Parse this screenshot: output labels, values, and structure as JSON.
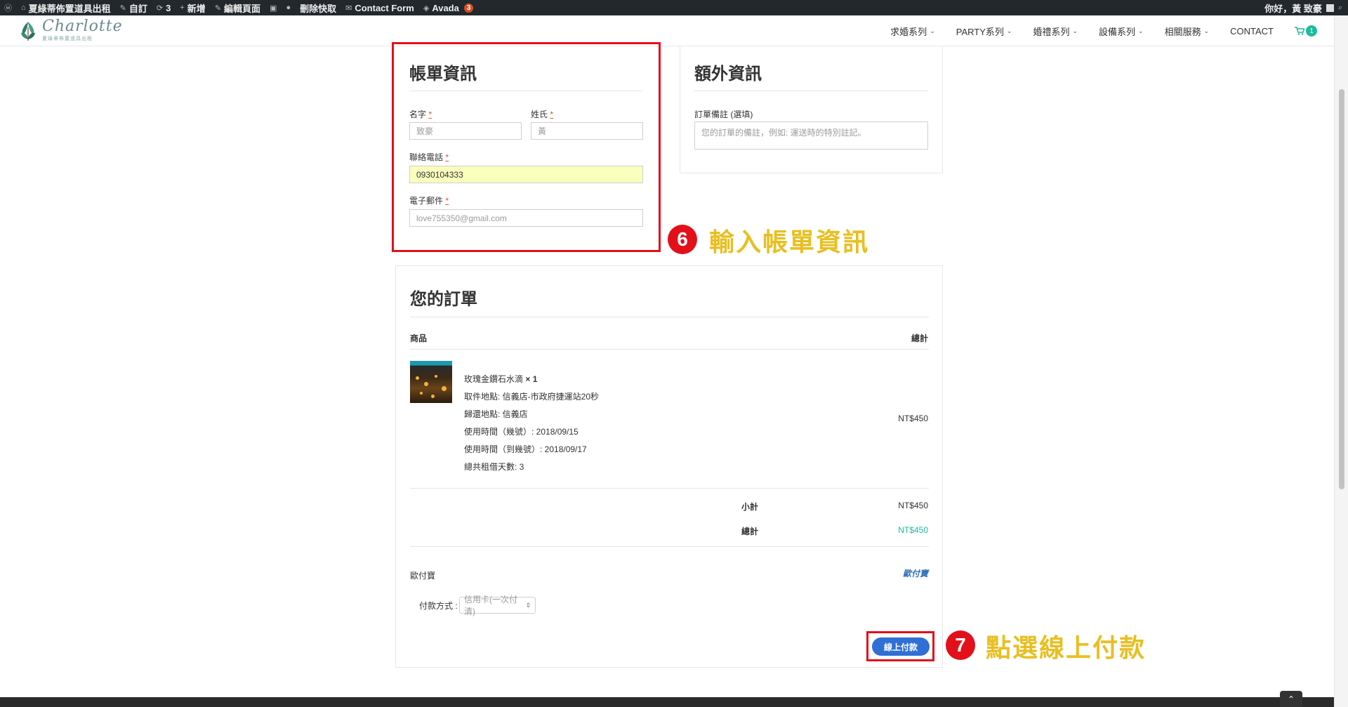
{
  "admin_bar": {
    "site_name": "夏綠蒂佈置道具出租",
    "customize": "自訂",
    "updates_count": "3",
    "new": "新增",
    "edit_page": "編輯頁面",
    "purge_cache": "刪除快取",
    "contact_form": "Contact Form",
    "avada": "Avada",
    "avada_badge": "3",
    "greeting": "你好，黃 致豪"
  },
  "header": {
    "logo_text": "Charlotte",
    "logo_sub": "夏綠蒂佈置道具出租",
    "nav": [
      {
        "label": "求婚系列"
      },
      {
        "label": "PARTY系列"
      },
      {
        "label": "婚禮系列"
      },
      {
        "label": "設備系列"
      },
      {
        "label": "相關服務"
      },
      {
        "label": "CONTACT"
      }
    ],
    "cart_count": "1"
  },
  "billing": {
    "title": "帳單資訊",
    "first_name_label": "名字",
    "first_name_placeholder": "致豪",
    "last_name_label": "姓氏",
    "last_name_placeholder": "黃",
    "phone_label": "聯絡電話",
    "phone_value": "0930104333",
    "email_label": "電子郵件",
    "email_placeholder": "love755350@gmail.com",
    "required_mark": "*"
  },
  "additional": {
    "title": "額外資訊",
    "notes_label": "訂單備註 (選填)",
    "notes_placeholder": "您的訂單的備註，例如: 運送時的特別註記。"
  },
  "order": {
    "title": "您的訂單",
    "col_product": "商品",
    "col_total": "總計",
    "item": {
      "name": "玫瑰金鑽石水滴",
      "qty": "× 1",
      "pickup": "取件地點: 信義店-市政府捷運站20秒",
      "return": "歸還地點: 信義店",
      "start": "使用時間（幾號）: 2018/09/15",
      "end": "使用時間（到幾號）: 2018/09/17",
      "days": "總共租借天數: 3",
      "price": "NT$450"
    },
    "subtotal_label": "小計",
    "subtotal": "NT$450",
    "total_label": "總計",
    "total": "NT$450",
    "payment_name": "歐付寶",
    "payment_logo": "歐付寶",
    "payment_method_label": "付款方式 :",
    "payment_method_value": "信用卡(一次付清)",
    "pay_button": "線上付款"
  },
  "annotations": {
    "step6_number": "6",
    "step6_text": "輸入帳單資訊",
    "step7_number": "7",
    "step7_text": "點選線上付款",
    "colors": {
      "frame": "#e3101a",
      "text": "#e8bf22"
    }
  },
  "colors": {
    "accent": "#1abc9c",
    "pay_button": "#2f6fd6",
    "admin_bar": "#23282d"
  }
}
